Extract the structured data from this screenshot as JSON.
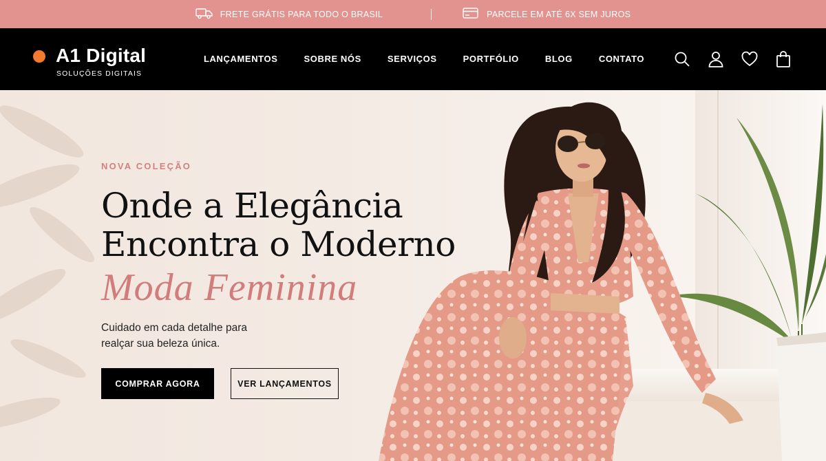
{
  "promo_bar": {
    "items": [
      {
        "icon": "truck-icon",
        "text": "FRETE GRÁTIS PARA TODO O BRASIL"
      },
      {
        "icon": "credit-card-icon",
        "text": "PARCELE EM ATÉ 6X SEM JUROS"
      }
    ]
  },
  "brand": {
    "name": "A1 Digital",
    "tagline": "SOLUÇÕES DIGITAIS",
    "accent": "#f47a2d"
  },
  "nav": {
    "items": [
      "LANÇAMENTOS",
      "SOBRE NÓS",
      "SERVIÇOS",
      "PORTFÓLIO",
      "BLOG",
      "CONTATO"
    ],
    "icons": [
      "search-icon",
      "user-icon",
      "heart-icon",
      "shopping-bag-icon"
    ]
  },
  "hero": {
    "eyebrow": "NOVA COLEÇÃO",
    "headline_line1": "Onde a Elegância",
    "headline_line2": "Encontra o Moderno",
    "script": "Moda Feminina",
    "description": "Cuidado em cada detalhe para realçar sua beleza única.",
    "primary_cta": "COMPRAR AGORA",
    "secondary_cta": "VER LANÇAMENTOS"
  },
  "colors": {
    "promo_bg": "#e2928f",
    "nav_bg": "#000000",
    "accent_pink": "#d07d7b",
    "logo_dot": "#f47a2d"
  }
}
